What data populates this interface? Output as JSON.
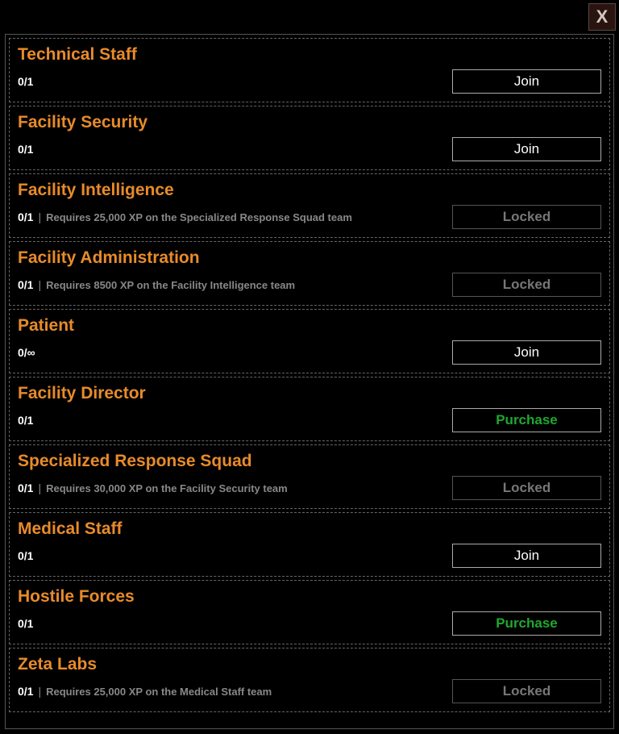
{
  "close_label": "X",
  "actions": {
    "join": "Join",
    "locked": "Locked",
    "purchase": "Purchase"
  },
  "teams": [
    {
      "name": "Technical Staff",
      "count": "0/1",
      "requirement": "",
      "action": "join"
    },
    {
      "name": "Facility Security",
      "count": "0/1",
      "requirement": "",
      "action": "join"
    },
    {
      "name": "Facility Intelligence",
      "count": "0/1",
      "requirement": "Requires 25,000 XP on the Specialized Response Squad team",
      "action": "locked"
    },
    {
      "name": "Facility Administration",
      "count": "0/1",
      "requirement": "Requires 8500 XP on the Facility Intelligence team",
      "action": "locked"
    },
    {
      "name": "Patient",
      "count": "0/∞",
      "requirement": "",
      "action": "join"
    },
    {
      "name": "Facility Director",
      "count": "0/1",
      "requirement": "",
      "action": "purchase"
    },
    {
      "name": "Specialized Response Squad",
      "count": "0/1",
      "requirement": "Requires 30,000 XP on the Facility Security team",
      "action": "locked"
    },
    {
      "name": "Medical Staff",
      "count": "0/1",
      "requirement": "",
      "action": "join"
    },
    {
      "name": "Hostile Forces",
      "count": "0/1",
      "requirement": "",
      "action": "purchase"
    },
    {
      "name": "Zeta Labs",
      "count": "0/1",
      "requirement": "Requires 25,000 XP on the Medical Staff team",
      "action": "locked"
    }
  ]
}
